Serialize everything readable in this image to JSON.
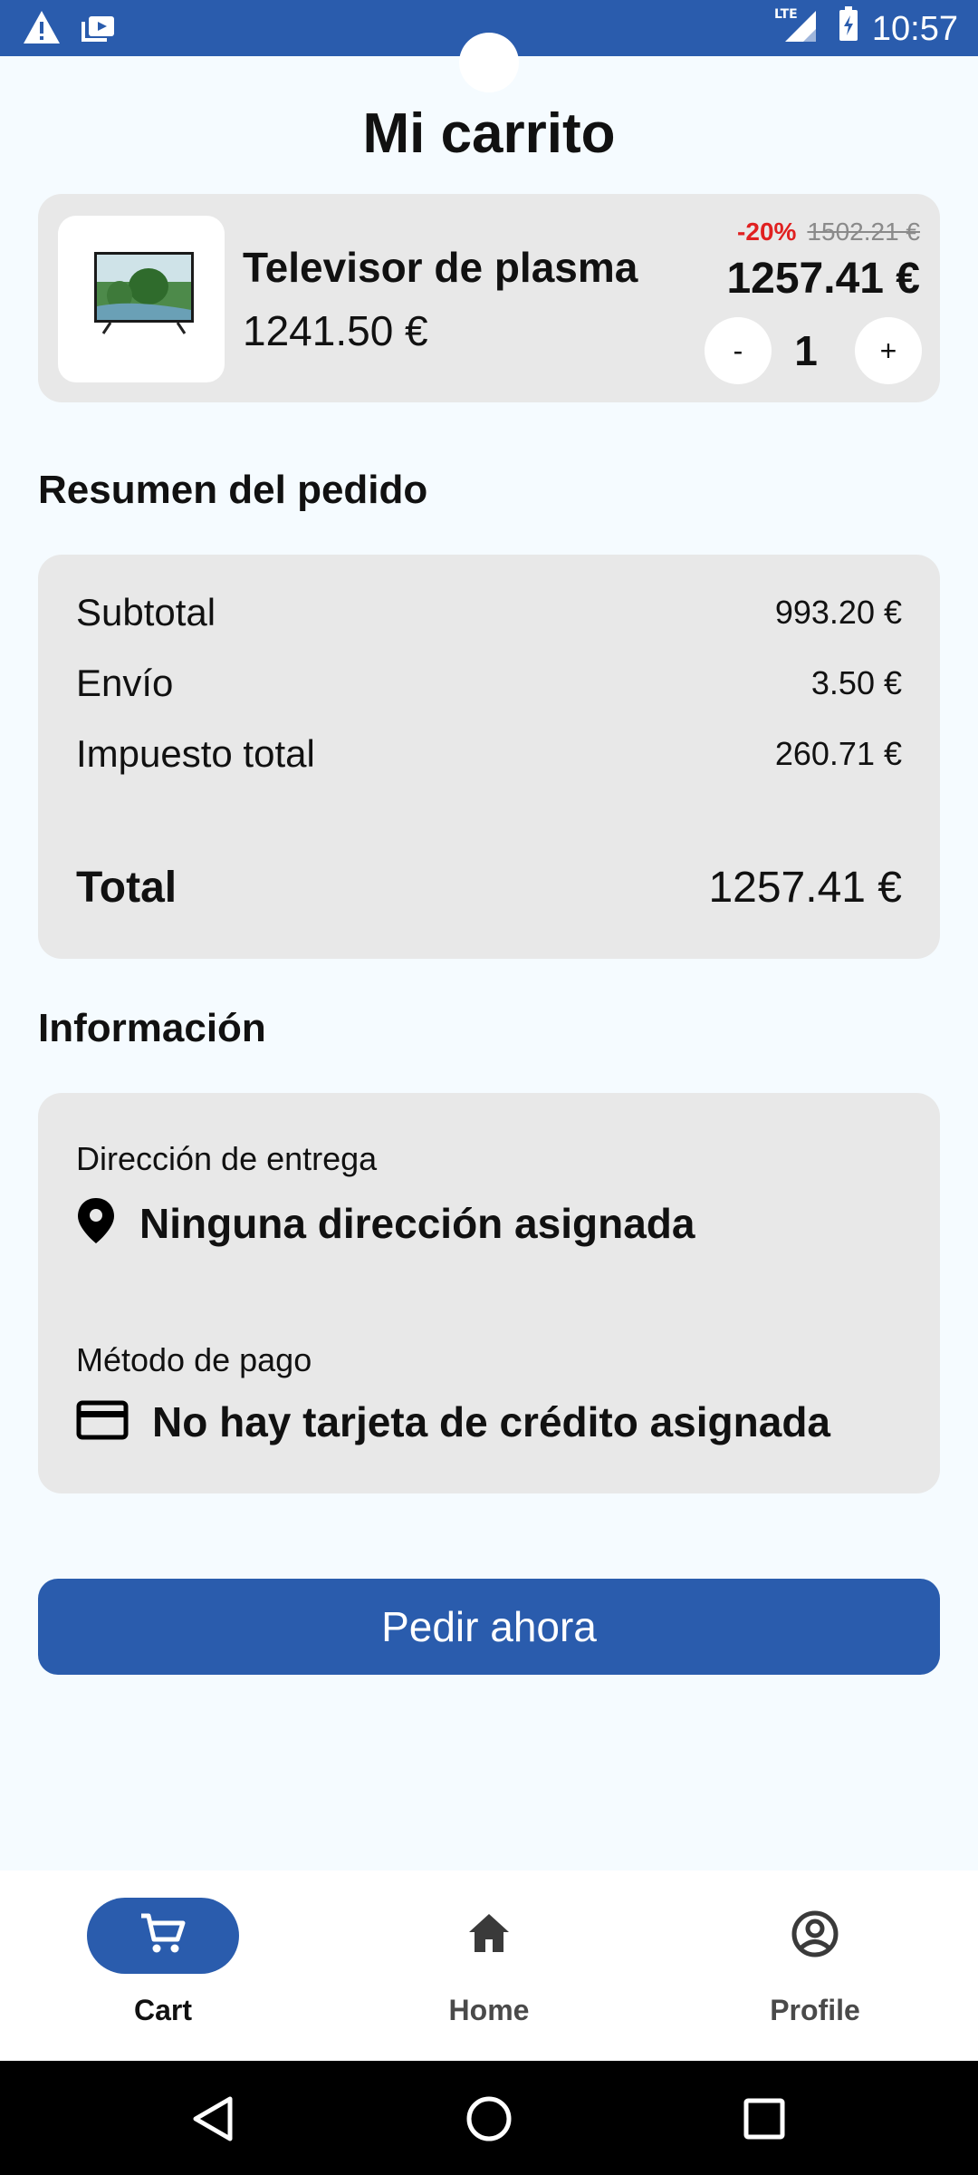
{
  "status_bar": {
    "network": "LTE",
    "time": "10:57"
  },
  "page": {
    "title": "Mi carrito"
  },
  "cart_item": {
    "name": "Televisor de plasma",
    "unit_price": "1241.50 €",
    "discount": "-20%",
    "original_price": "1502.21 €",
    "total_price": "1257.41 €",
    "quantity": "1",
    "decrement_label": "-",
    "increment_label": "+"
  },
  "summary": {
    "heading": "Resumen del pedido",
    "rows": [
      {
        "label": "Subtotal",
        "value": "993.20 €"
      },
      {
        "label": "Envío",
        "value": "3.50 €"
      },
      {
        "label": "Impuesto total",
        "value": "260.71 €"
      }
    ],
    "total_label": "Total",
    "total_value": "1257.41 €"
  },
  "info": {
    "heading": "Información",
    "address_label": "Dirección de entrega",
    "address_value": "Ninguna dirección asignada",
    "payment_label": "Método de pago",
    "payment_value": "No hay tarjeta de crédito asignada"
  },
  "order_button": {
    "label": "Pedir ahora"
  },
  "bottom_nav": {
    "items": [
      {
        "label": "Cart",
        "icon": "cart-icon",
        "active": true
      },
      {
        "label": "Home",
        "icon": "home-icon",
        "active": false
      },
      {
        "label": "Profile",
        "icon": "profile-icon",
        "active": false
      }
    ]
  },
  "colors": {
    "primary": "#2a5cad",
    "discount": "#e02020",
    "card": "#e8e8e8",
    "background": "#f5fbff"
  }
}
